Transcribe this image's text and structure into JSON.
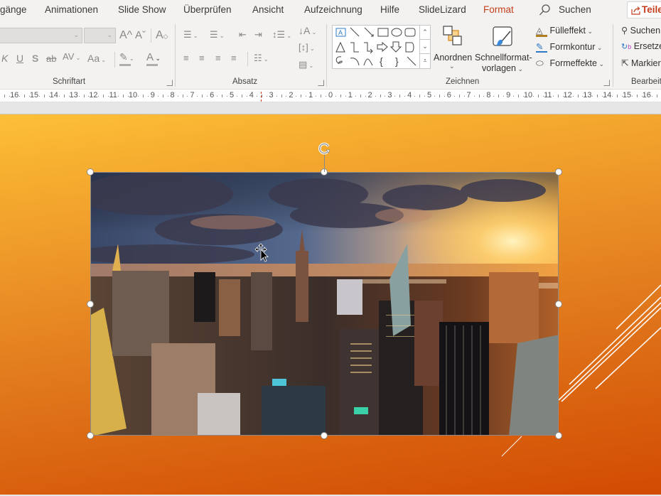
{
  "tabs": [
    {
      "label": "gänge",
      "active": false
    },
    {
      "label": "Animationen",
      "active": false
    },
    {
      "label": "Slide Show",
      "active": false
    },
    {
      "label": "Überprüfen",
      "active": false
    },
    {
      "label": "Ansicht",
      "active": false
    },
    {
      "label": "Aufzeichnung",
      "active": false
    },
    {
      "label": "Hilfe",
      "active": false
    },
    {
      "label": "SlideLizard",
      "active": false
    },
    {
      "label": "Format",
      "active": true
    }
  ],
  "search": {
    "label": "Suchen",
    "icon": "search-icon"
  },
  "share": {
    "label": "Teilen",
    "icon": "share-icon"
  },
  "ribbon": {
    "groups": {
      "font": {
        "label": "Schriftart"
      },
      "paragraph": {
        "label": "Absatz"
      },
      "drawing": {
        "label": "Zeichnen"
      },
      "editing": {
        "label": "Bearbeiten"
      }
    },
    "font": {
      "font_name": "",
      "font_size": "",
      "grow_font": "A^",
      "shrink_font": "Aˇ",
      "clear_format": "A",
      "italic": "K",
      "underline": "U",
      "shadow": "S",
      "strikethrough": "ab",
      "char_spacing": "AV",
      "change_case": "Aa",
      "font_color": "A"
    },
    "drawing": {
      "arrange": "Anordnen",
      "quick_styles_1": "Schnellformat-",
      "quick_styles_2": "vorlagen"
    },
    "format": {
      "fill": "Fülleffekt",
      "outline": "Formkontur",
      "effects": "Formeffekte"
    },
    "editing": {
      "find": "Suchen",
      "replace": "Ersetzen",
      "select": "Markieren"
    }
  },
  "ruler": {
    "left_labels": [
      "16",
      "15",
      "14",
      "13",
      "12",
      "11",
      "10",
      "9",
      "8",
      "7",
      "6",
      "5",
      "4",
      "3",
      "2",
      "1"
    ],
    "center_label": "0",
    "right_labels": [
      "1",
      "2",
      "3",
      "4",
      "5",
      "6",
      "7",
      "8",
      "9",
      "10",
      "11",
      "12",
      "13",
      "14",
      "15",
      "16"
    ]
  },
  "colors": {
    "accent": "#c43e1c",
    "slide_top": "#fdc038",
    "slide_bottom": "#d24b03"
  },
  "slide": {
    "image": {
      "description": "New York City skyline at sunset",
      "selected": true
    }
  }
}
